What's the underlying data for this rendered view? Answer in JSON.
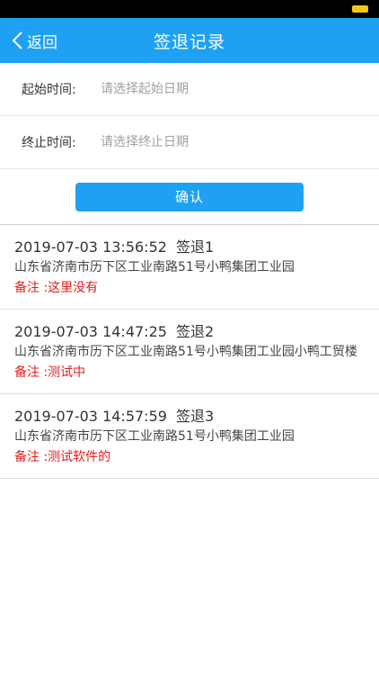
{
  "nav": {
    "back_label": "返回",
    "title": "签退记录"
  },
  "form": {
    "start": {
      "label": "起始时间:",
      "placeholder": "请选择起始日期"
    },
    "end": {
      "label": "终止时间:",
      "placeholder": "请选择终止日期"
    },
    "confirm_label": "确认"
  },
  "records": [
    {
      "datetime": "2019-07-03 13:56:52",
      "type": "签退1",
      "address": "山东省济南市历下区工业南路51号小鸭集团工业园",
      "note": "备注 :这里没有"
    },
    {
      "datetime": "2019-07-03 14:47:25",
      "type": "签退2",
      "address": "山东省济南市历下区工业南路51号小鸭集团工业园小鸭工贸楼",
      "note": "备注 :测试中"
    },
    {
      "datetime": "2019-07-03 14:57:59",
      "type": "签退3",
      "address": "山东省济南市历下区工业南路51号小鸭集团工业园",
      "note": "备注 :测试软件的"
    }
  ],
  "icons": {
    "back": "chevron-left-icon",
    "battery": "battery-icon"
  },
  "colors": {
    "accent": "#1ea1f2",
    "note": "#e02020"
  }
}
